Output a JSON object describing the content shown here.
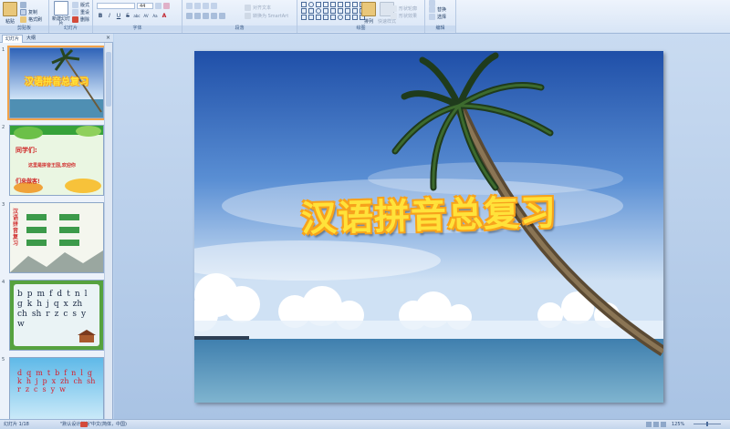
{
  "ribbon": {
    "groups": [
      {
        "label": "剪贴板",
        "buttons": [
          "粘贴",
          "复制",
          "格式刷"
        ]
      },
      {
        "label": "幻灯片",
        "buttons": [
          "新建幻灯片",
          "版式",
          "重设",
          "删除"
        ]
      },
      {
        "label": "字体",
        "font_size": "44",
        "format": [
          "B",
          "I",
          "U",
          "S",
          "abc",
          "AV",
          "Aa",
          "A"
        ]
      },
      {
        "label": "段落",
        "buttons": [
          "对齐文本",
          "转换为 SmartArt"
        ]
      },
      {
        "label": "绘图",
        "buttons": [
          "排列",
          "快速样式",
          "形状轮廓",
          "形状效果"
        ]
      },
      {
        "label": "编辑",
        "buttons": [
          "替换",
          "选择"
        ]
      }
    ]
  },
  "panel": {
    "tabs": [
      "幻灯片",
      "大纲"
    ],
    "close": "×",
    "thumbs": [
      {
        "num": "1",
        "title": "汉语拼音总复习"
      },
      {
        "num": "2",
        "lines": [
          "同学们:",
          "这里是拼音王国,欢迎你",
          "们来做客!"
        ]
      },
      {
        "num": "3",
        "side": "汉语拼音复习"
      },
      {
        "num": "4",
        "letters": [
          "b",
          "p",
          "m",
          "f",
          "d",
          "t",
          "n",
          "l",
          "g",
          "k",
          "h",
          "j",
          "q",
          "x",
          "zh",
          "ch",
          "sh",
          "r",
          "z",
          "c",
          "s",
          "y",
          "w"
        ]
      },
      {
        "num": "5",
        "letters": [
          "d",
          "q",
          "m",
          "t",
          "b",
          "f",
          "n",
          "l",
          "g",
          "k",
          "h",
          "j",
          "p",
          "x",
          "zh",
          "ch",
          "sh",
          "r",
          "z",
          "c",
          "s",
          "y",
          "w"
        ]
      }
    ]
  },
  "slide": {
    "title": "汉语拼音总复习"
  },
  "status": {
    "slide_count": "幻灯片 1/18",
    "theme": "\"默认设计模板\"",
    "language": "中文(简体，中国)",
    "zoom": "125%"
  },
  "colors": {
    "title_fill": "#ffe23a",
    "title_outline": "#f7a21c",
    "selection": "#f2a24a"
  }
}
